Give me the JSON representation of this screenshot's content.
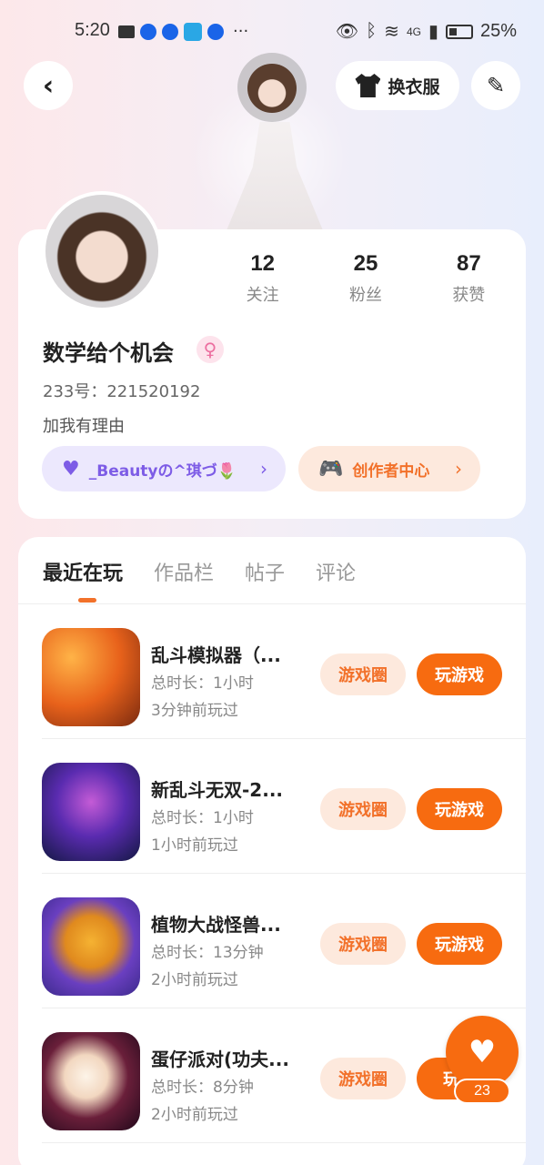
{
  "status_bar": {
    "time": "5:20",
    "signal_label": "4G",
    "battery": "25%",
    "more": "···"
  },
  "top_bar": {
    "back_icon": "‹",
    "dress_label": "换衣服",
    "edit_icon": "✎"
  },
  "profile": {
    "stats": [
      {
        "value": "12",
        "label": "关注"
      },
      {
        "value": "25",
        "label": "粉丝"
      },
      {
        "value": "87",
        "label": "获赞"
      }
    ],
    "username": "数学给个机会",
    "gender_symbol": "♀",
    "user_id": "233号：221520192",
    "bio": "加我有理由",
    "tag_beauty": "_Beautyの^琪づ🌷",
    "tag_creator": "创作者中心"
  },
  "tabs": [
    {
      "label": "最近在玩",
      "active": true
    },
    {
      "label": "作品栏",
      "active": false
    },
    {
      "label": "帖子",
      "active": false
    },
    {
      "label": "评论",
      "active": false
    }
  ],
  "games": [
    {
      "title": "乱斗模拟器（...",
      "duration": "总时长：1小时",
      "last_played": "3分钟前玩过",
      "circle_label": "游戏圈",
      "play_label": "玩游戏"
    },
    {
      "title": "新乱斗无双-2...",
      "duration": "总时长：1小时",
      "last_played": "1小时前玩过",
      "circle_label": "游戏圈",
      "play_label": "玩游戏"
    },
    {
      "title": "植物大战怪兽...",
      "duration": "总时长：13分钟",
      "last_played": "2小时前玩过",
      "circle_label": "游戏圈",
      "play_label": "玩游戏"
    },
    {
      "title": "蛋仔派对(功夫...",
      "duration": "总时长：8分钟",
      "last_played": "2小时前玩过",
      "circle_label": "游戏圈",
      "play_label": "玩游"
    }
  ],
  "fab": {
    "count": "23"
  },
  "colors": {
    "accent": "#f76b10",
    "accent_light": "#fde9dd",
    "purple": "#7d5ce6",
    "purple_light": "#ece8fd"
  }
}
